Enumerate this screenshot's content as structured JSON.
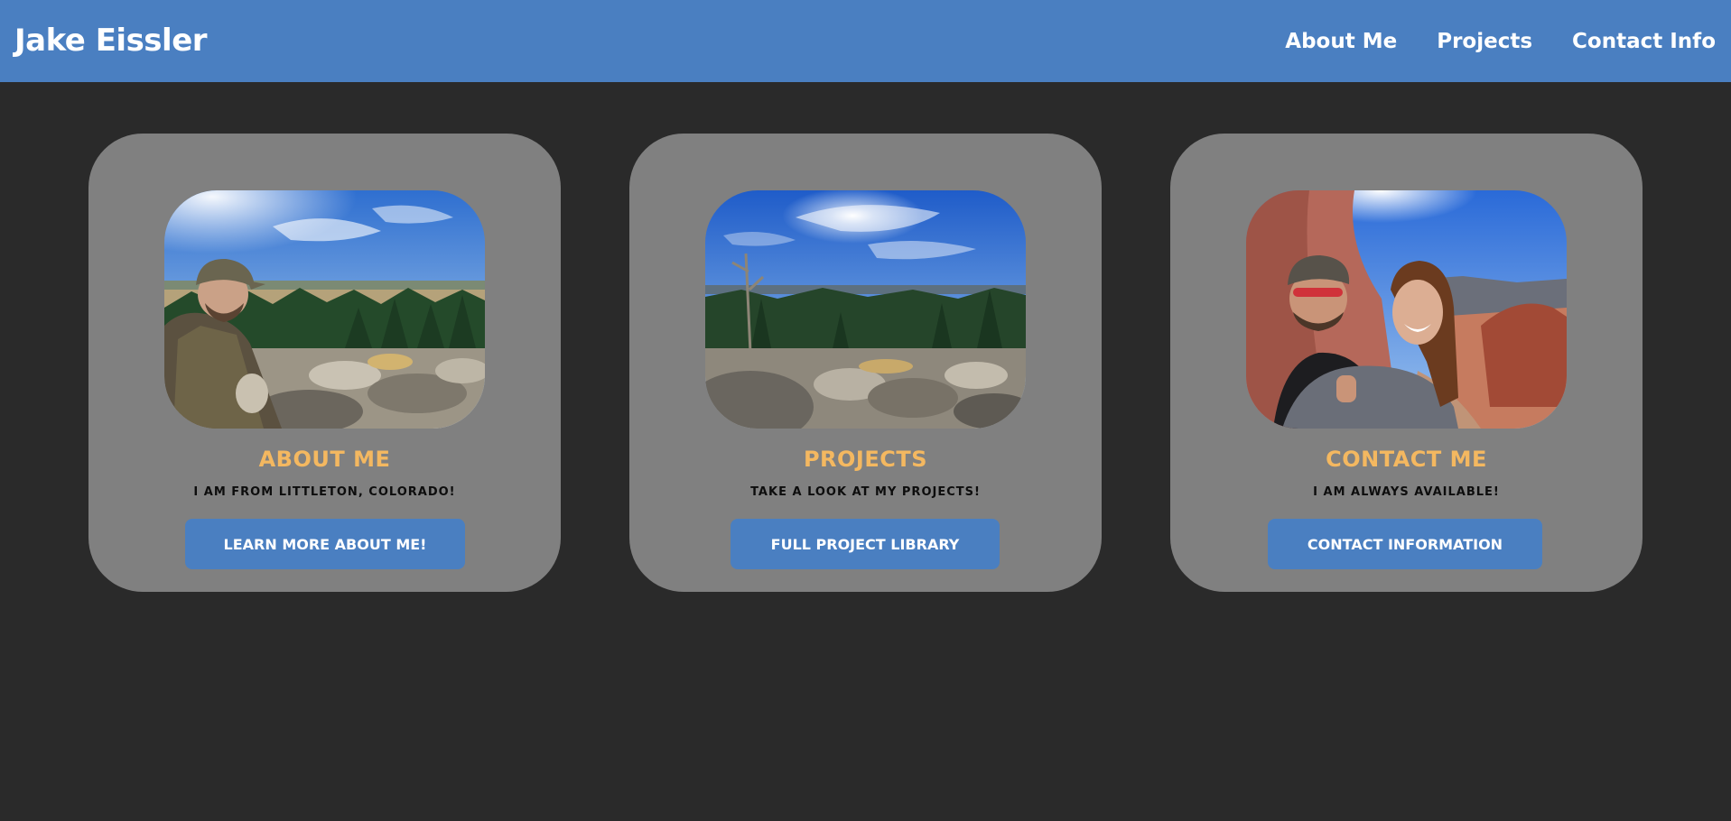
{
  "header": {
    "title": "Jake Eissler",
    "nav": [
      "About Me",
      "Projects",
      "Contact Info"
    ]
  },
  "cards": [
    {
      "title": "About Me",
      "text": "I am from Littleton, Colorado!",
      "button": "Learn more about me!"
    },
    {
      "title": "Projects",
      "text": "Take a look at my projects!",
      "button": "Full Project Library"
    },
    {
      "title": "Contact Me",
      "text": "I am always available!",
      "button": "Contact Information"
    }
  ],
  "colors": {
    "header": "#4a7fc1",
    "background": "#2a2a2a",
    "card": "#808080",
    "card_title": "#f4b860",
    "button": "#4a7fc1"
  }
}
